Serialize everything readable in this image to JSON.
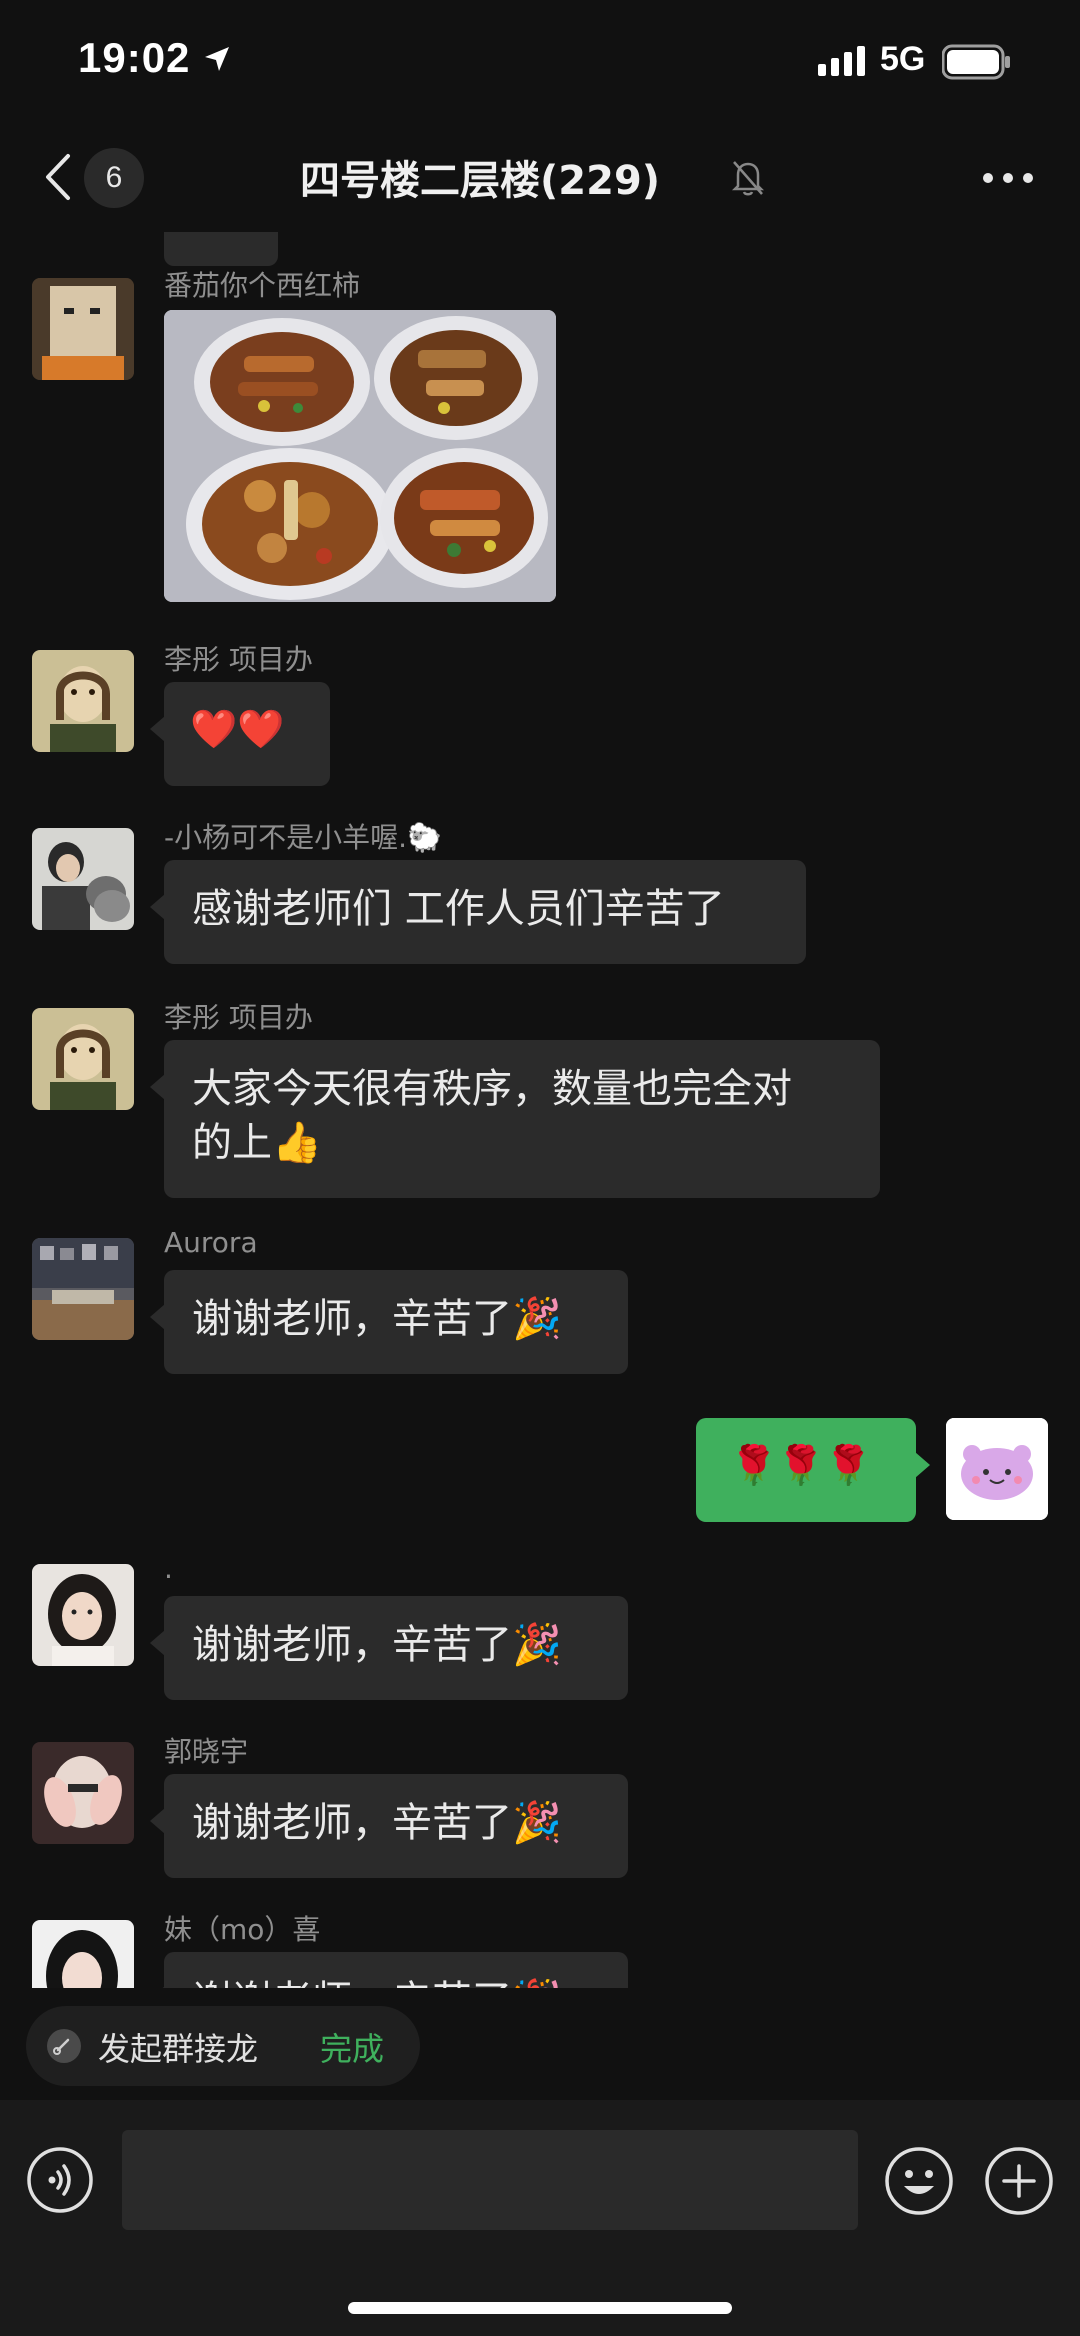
{
  "status_bar": {
    "time": "19:02",
    "network": "5G"
  },
  "nav": {
    "unread_count": "6",
    "title": "四号楼二层楼(229)"
  },
  "messages": [
    {
      "sender": "番茄你个西红柿",
      "type": "image"
    },
    {
      "sender": "李彤 项目办",
      "text": "❤️❤️"
    },
    {
      "sender": "-小杨可不是小羊喔.🐑",
      "text": "感谢老师们 工作人员们辛苦了"
    },
    {
      "sender": "李彤 项目办",
      "text_line1": "大家今天很有秩序，数量也完全对",
      "text_line2": "的上👍"
    },
    {
      "sender": "Aurora",
      "text": "谢谢老师，辛苦了🎉"
    },
    {
      "sender": "me",
      "text": "🌹🌹🌹"
    },
    {
      "sender": ".",
      "text": "谢谢老师，辛苦了🎉"
    },
    {
      "sender": "郭晓宇",
      "text": "谢谢老师，辛苦了🎉"
    },
    {
      "sender": "妹（mo）喜",
      "text": "谢谢老师，辛苦了🎉"
    }
  ],
  "jielong": {
    "label": "发起群接龙",
    "done": "完成"
  },
  "input": {
    "placeholder": ""
  },
  "colors": {
    "background": "#111111",
    "bubble_left": "#2b2b2b",
    "bubble_right": "#3fb05d",
    "accent_green": "#3fb05d"
  }
}
